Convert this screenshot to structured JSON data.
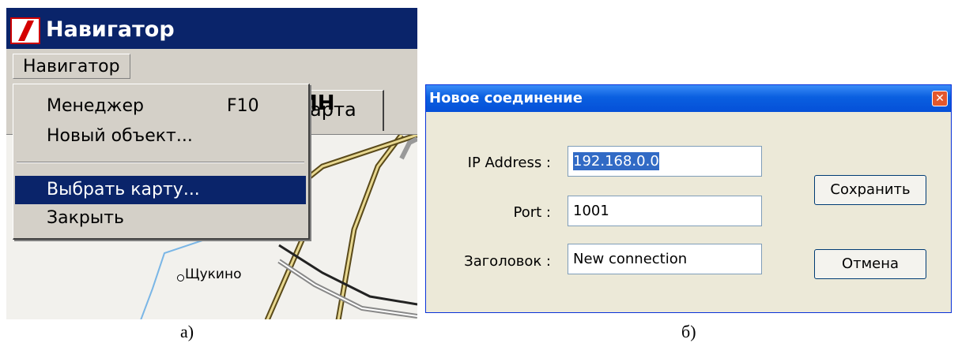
{
  "panel_a": {
    "window_title": "Навигатор",
    "menubar": {
      "menu_label": "Навигатор"
    },
    "tab_label": "Карта",
    "dropdown": {
      "items": [
        {
          "label": "Менеджер",
          "shortcut": "F10"
        },
        {
          "label": "Новый объект..."
        },
        {
          "label": "Выбрать карту...",
          "selected": true
        },
        {
          "label": "Закрыть"
        }
      ]
    },
    "map": {
      "city_label_fragment": "ИН",
      "village_label": "Щукино"
    },
    "colors": {
      "titlebar": "#0a246a",
      "highlight": "#0a246a"
    }
  },
  "panel_b": {
    "dialog_title": "Новое соединение",
    "close_icon": "close-icon",
    "fields": {
      "ip_label": "IP Address :",
      "ip_value": "192.168.0.0",
      "port_label": "Port :",
      "port_value": "1001",
      "title_label": "Заголовок :",
      "title_value": "New connection"
    },
    "buttons": {
      "save": "Сохранить",
      "cancel": "Отмена"
    },
    "colors": {
      "titlebar": "#0a5fe0",
      "close": "#e3582d"
    }
  },
  "captions": {
    "a": "а)",
    "b": "б)"
  }
}
